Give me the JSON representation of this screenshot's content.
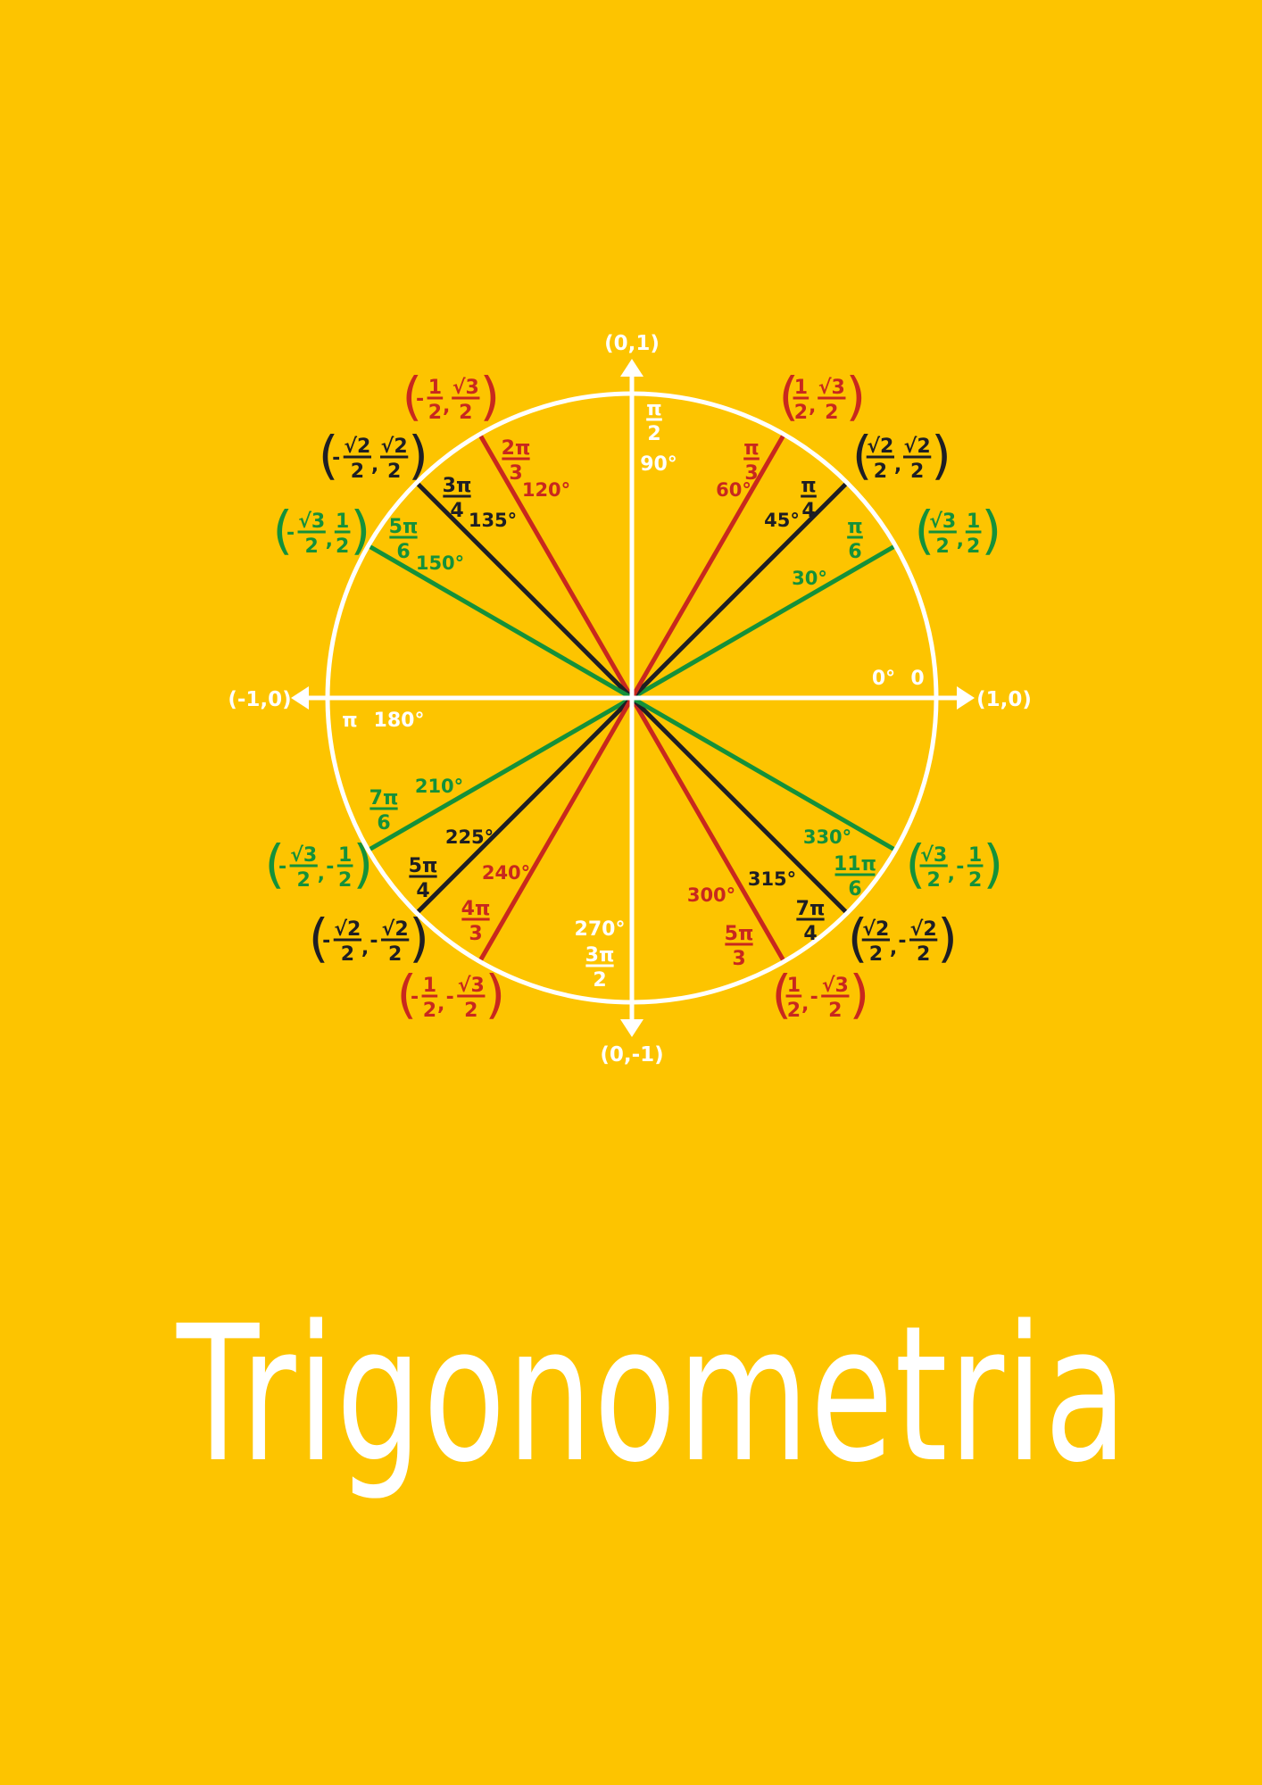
{
  "colors": {
    "background": "#FDC400",
    "white": "#ffffff",
    "red": "#C8281E",
    "black": "#1E1E24",
    "green": "#14913A"
  },
  "title": "Trigonometria",
  "axes": {
    "top": "(0,1)",
    "bottom": "(0,-1)",
    "left": "(-1,0)",
    "right": "(1,0)"
  },
  "angles": [
    {
      "deg": 0,
      "deg_label": "0°",
      "rad": {
        "plain": "0"
      },
      "color": "white",
      "line": false,
      "point": null
    },
    {
      "deg": 30,
      "deg_label": "30°",
      "rad": {
        "num": "π",
        "den": "6"
      },
      "color": "green",
      "line": true,
      "point": {
        "sx": "",
        "xn": "√3",
        "xd": "2",
        "sy": "",
        "yn": "1",
        "yd": "2"
      }
    },
    {
      "deg": 45,
      "deg_label": "45°",
      "rad": {
        "num": "π",
        "den": "4"
      },
      "color": "black",
      "line": true,
      "point": {
        "sx": "",
        "xn": "√2",
        "xd": "2",
        "sy": "",
        "yn": "√2",
        "yd": "2"
      }
    },
    {
      "deg": 60,
      "deg_label": "60°",
      "rad": {
        "num": "π",
        "den": "3"
      },
      "color": "red",
      "line": true,
      "point": {
        "sx": "",
        "xn": "1",
        "xd": "2",
        "sy": "",
        "yn": "√3",
        "yd": "2"
      }
    },
    {
      "deg": 90,
      "deg_label": "90°",
      "rad": {
        "num": "π",
        "den": "2"
      },
      "color": "white",
      "line": false,
      "point": null
    },
    {
      "deg": 120,
      "deg_label": "120°",
      "rad": {
        "num": "2π",
        "den": "3"
      },
      "color": "red",
      "line": true,
      "point": {
        "sx": "-",
        "xn": "1",
        "xd": "2",
        "sy": "",
        "yn": "√3",
        "yd": "2"
      }
    },
    {
      "deg": 135,
      "deg_label": "135°",
      "rad": {
        "num": "3π",
        "den": "4"
      },
      "color": "black",
      "line": true,
      "point": {
        "sx": "-",
        "xn": "√2",
        "xd": "2",
        "sy": "",
        "yn": "√2",
        "yd": "2"
      }
    },
    {
      "deg": 150,
      "deg_label": "150°",
      "rad": {
        "num": "5π",
        "den": "6"
      },
      "color": "green",
      "line": true,
      "point": {
        "sx": "-",
        "xn": "√3",
        "xd": "2",
        "sy": "",
        "yn": "1",
        "yd": "2"
      }
    },
    {
      "deg": 180,
      "deg_label": "180°",
      "rad": {
        "plain": "π"
      },
      "color": "white",
      "line": false,
      "point": null
    },
    {
      "deg": 210,
      "deg_label": "210°",
      "rad": {
        "num": "7π",
        "den": "6"
      },
      "color": "green",
      "line": true,
      "point": {
        "sx": "-",
        "xn": "√3",
        "xd": "2",
        "sy": "-",
        "yn": "1",
        "yd": "2"
      }
    },
    {
      "deg": 225,
      "deg_label": "225°",
      "rad": {
        "num": "5π",
        "den": "4"
      },
      "color": "black",
      "line": true,
      "point": {
        "sx": "-",
        "xn": "√2",
        "xd": "2",
        "sy": "-",
        "yn": "√2",
        "yd": "2"
      }
    },
    {
      "deg": 240,
      "deg_label": "240°",
      "rad": {
        "num": "4π",
        "den": "3"
      },
      "color": "red",
      "line": true,
      "point": {
        "sx": "-",
        "xn": "1",
        "xd": "2",
        "sy": "-",
        "yn": "√3",
        "yd": "2"
      }
    },
    {
      "deg": 270,
      "deg_label": "270°",
      "rad": {
        "num": "3π",
        "den": "2"
      },
      "color": "white",
      "line": false,
      "point": null
    },
    {
      "deg": 300,
      "deg_label": "300°",
      "rad": {
        "num": "5π",
        "den": "3"
      },
      "color": "red",
      "line": true,
      "point": {
        "sx": "",
        "xn": "1",
        "xd": "2",
        "sy": "-",
        "yn": "√3",
        "yd": "2"
      }
    },
    {
      "deg": 315,
      "deg_label": "315°",
      "rad": {
        "num": "7π",
        "den": "4"
      },
      "color": "black",
      "line": true,
      "point": {
        "sx": "",
        "xn": "√2",
        "xd": "2",
        "sy": "-",
        "yn": "√2",
        "yd": "2"
      }
    },
    {
      "deg": 330,
      "deg_label": "330°",
      "rad": {
        "num": "11π",
        "den": "6"
      },
      "color": "green",
      "line": true,
      "point": {
        "sx": "",
        "xn": "√3",
        "xd": "2",
        "sy": "-",
        "yn": "1",
        "yd": "2"
      }
    }
  ]
}
